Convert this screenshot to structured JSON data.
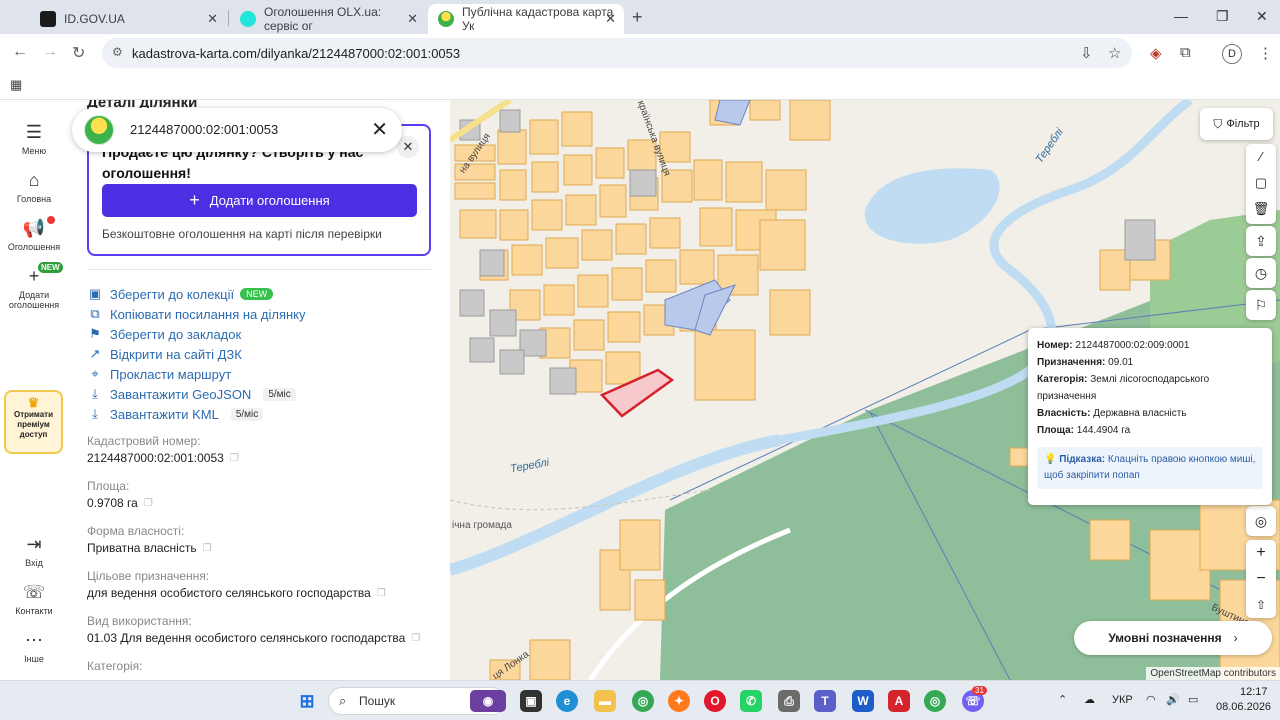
{
  "browser": {
    "tabs": [
      {
        "title": "ID.GOV.UA",
        "color": "#1a1a1a"
      },
      {
        "title": "Оголошення OLX.ua: сервіс ог",
        "color": "#23e5db"
      },
      {
        "title": "Публічна кадастрова карта Ук",
        "color": "#3db24b"
      }
    ],
    "new_tab": "+",
    "url": "kadastrova-karta.com/dilyanka/2124487000:02:001:0053",
    "profile_initial": "D"
  },
  "rail": {
    "menu": "Меню",
    "home": "Головна",
    "ads": "Оголошення",
    "add_ad": "Додати оголошення",
    "new_badge": "NEW",
    "premium": "Отримати преміум доступ",
    "login": "Вхід",
    "contacts": "Контакти",
    "other": "Інше"
  },
  "search": {
    "value": "2124487000:02:001:0053"
  },
  "panel": {
    "title": "Деталі ділянки",
    "promo_heading": "Продаєте цю ділянку? Створіть у нас оголошення!",
    "promo_button": "Додати оголошення",
    "promo_note": "Безкоштовне оголошення на карті після перевірки",
    "actions": {
      "save_collection": "Зберегти до колекції",
      "new_badge": "NEW",
      "copy_link": "Копіювати посилання на ділянку",
      "bookmark": "Зберегти до закладок",
      "open_dzk": "Відкрити на сайті ДЗК",
      "route": "Прокласти маршрут",
      "geojson": "Завантажити GeoJSON",
      "geojson_limit": "5/міс",
      "kml": "Завантажити KML",
      "kml_limit": "5/міс"
    },
    "fields": {
      "cadastral_label": "Кадастровий номер:",
      "cadastral_value": "2124487000:02:001:0053",
      "area_label": "Площа:",
      "area_value": "0.9708 га",
      "ownership_label": "Форма власності:",
      "ownership_value": "Приватна власність",
      "purpose_label": "Цільове призначення:",
      "purpose_value": "для ведення особистого селянського господарства",
      "usage_label": "Вид використання:",
      "usage_value": "01.03 Для ведення особистого селянського господарства",
      "category_label": "Категорія:"
    }
  },
  "map": {
    "filter": "Фільтр",
    "legend": "Умовні позначення",
    "attribution": "OpenStreetMap contributors",
    "labels": {
      "river1": "Тереблі",
      "river2": "Тереблі",
      "street1": "на вулиця",
      "street2": "Українська вулиця",
      "community": "ічна громада",
      "street3": "Буштинс",
      "street4": "ця Лонка"
    },
    "popup": {
      "number_label": "Номер:",
      "number_value": "2124487000:02:009:0001",
      "purpose_label": "Призначення:",
      "purpose_value": "09.01",
      "category_label": "Категорія:",
      "category_value": "Землі лісогосподарського призначення",
      "ownership_label": "Власність:",
      "ownership_value": "Державна власність",
      "area_label": "Площа:",
      "area_value": "144.4904 га",
      "hint_label": "Підказка:",
      "hint_text": "Клацніть правою кнопкою миші, щоб закріпити попап"
    }
  },
  "taskbar": {
    "search": "Пошук",
    "lang": "УКР",
    "time": "12:17",
    "date": "08.06.2026",
    "viber_badge": "31"
  },
  "colors": {
    "accent": "#4b2fe3",
    "link": "#2b6cb0",
    "parcel_fill": "#fbd79b",
    "forest": "#8fbf9a",
    "water": "#bfdcf2",
    "selected": "#d4212a"
  }
}
